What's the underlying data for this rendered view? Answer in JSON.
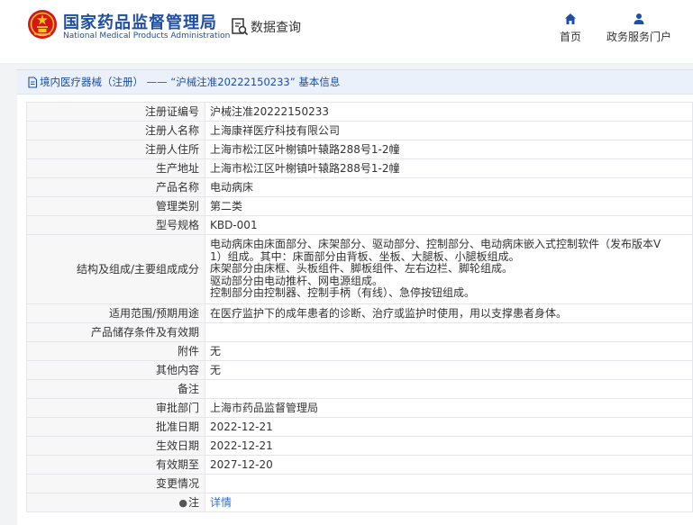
{
  "header": {
    "logo_cn": "国家药品监督管理局",
    "logo_en": "National Medical Products Administration",
    "query_label": "数据查询",
    "nav": [
      {
        "label": "首页",
        "icon": "home-icon"
      },
      {
        "label": "政务服务门户",
        "icon": "user-icon"
      }
    ],
    "brand_color": "#1f4fa4"
  },
  "panel": {
    "title": "境内医疗器械（注册） —— “沪械注准20222150233” 基本信息",
    "rows": [
      {
        "key": "注册证编号",
        "value": "沪械注准20222150233"
      },
      {
        "key": "注册人名称",
        "value": "上海康祥医疗科技有限公司"
      },
      {
        "key": "注册人住所",
        "value": "上海市松江区叶榭镇叶辕路288号1-2幢"
      },
      {
        "key": "生产地址",
        "value": "上海市松江区叶榭镇叶辕路288号1-2幢"
      },
      {
        "key": "产品名称",
        "value": "电动病床"
      },
      {
        "key": "管理类别",
        "value": "第二类"
      },
      {
        "key": "型号规格",
        "value": "KBD-001"
      },
      {
        "key": "结构及组成/主要组成成分",
        "lines": [
          "电动病床由床面部分、床架部分、驱动部分、控制部分、电动病床嵌入式控制软件（发布版本V",
          "1）组成。其中：床面部分由背板、坐板、大腿板、小腿板组成。",
          "床架部分由床框、头板组件、脚板组件、左右边栏、脚轮组成。",
          "驱动部分由电动推杆、网电源组成。",
          "控制部分由控制器、控制手柄（有线）、急停按钮组成。"
        ]
      },
      {
        "key": "适用范围/预期用途",
        "value": "在医疗监护下的成年患者的诊断、治疗或监护时使用，用以支撑患者身体。"
      },
      {
        "key": "产品储存条件及有效期",
        "value": ""
      },
      {
        "key": "附件",
        "value": "无"
      },
      {
        "key": "其他内容",
        "value": "无"
      },
      {
        "key": "备注",
        "value": ""
      },
      {
        "key": "审批部门",
        "value": "上海市药品监督管理局"
      },
      {
        "key": "批准日期",
        "value": "2022-12-21"
      },
      {
        "key": "生效日期",
        "value": "2022-12-21"
      },
      {
        "key": "有效期至",
        "value": "2027-12-20"
      },
      {
        "key": "变更情况",
        "value": ""
      },
      {
        "key": "注",
        "value": "详情",
        "key_icon": "pin-icon"
      }
    ]
  }
}
